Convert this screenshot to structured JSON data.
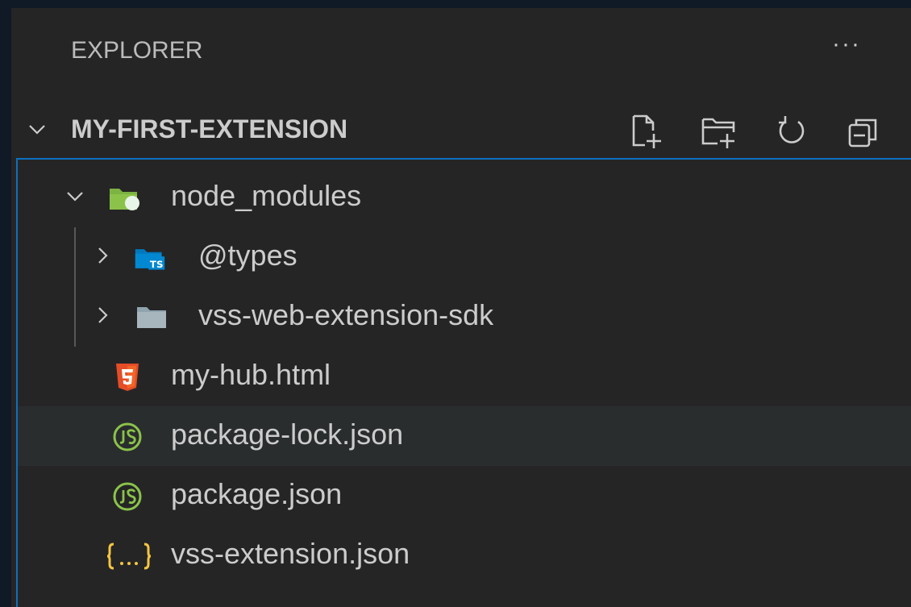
{
  "explorer": {
    "title": "EXPLORER",
    "more_label": "···"
  },
  "section": {
    "title": "MY-FIRST-EXTENSION",
    "actions": [
      "new-file-icon",
      "new-folder-icon",
      "refresh-icon",
      "collapse-all-icon"
    ]
  },
  "tree": {
    "items": [
      {
        "label": "node_modules",
        "type": "folder",
        "expanded": true,
        "icon": "node-folder-icon",
        "color": "#8bc34a"
      },
      {
        "label": "@types",
        "type": "folder",
        "expanded": false,
        "icon": "ts-folder-icon",
        "color": "#0288d1"
      },
      {
        "label": "vss-web-extension-sdk",
        "type": "folder",
        "expanded": false,
        "icon": "folder-icon",
        "color": "#90a4ae"
      },
      {
        "label": "my-hub.html",
        "type": "file",
        "icon": "html5-icon",
        "color": "#e44d26"
      },
      {
        "label": "package-lock.json",
        "type": "file",
        "icon": "nodejs-icon",
        "color": "#8bc34a",
        "selected": true
      },
      {
        "label": "package.json",
        "type": "file",
        "icon": "nodejs-icon",
        "color": "#8bc34a"
      },
      {
        "label": "vss-extension.json",
        "type": "file",
        "icon": "json-icon",
        "color": "#f5c542"
      }
    ]
  },
  "colors": {
    "focus_border": "#0e70c0",
    "panel_bg": "#252526",
    "selected_bg": "#2a2d2e"
  }
}
